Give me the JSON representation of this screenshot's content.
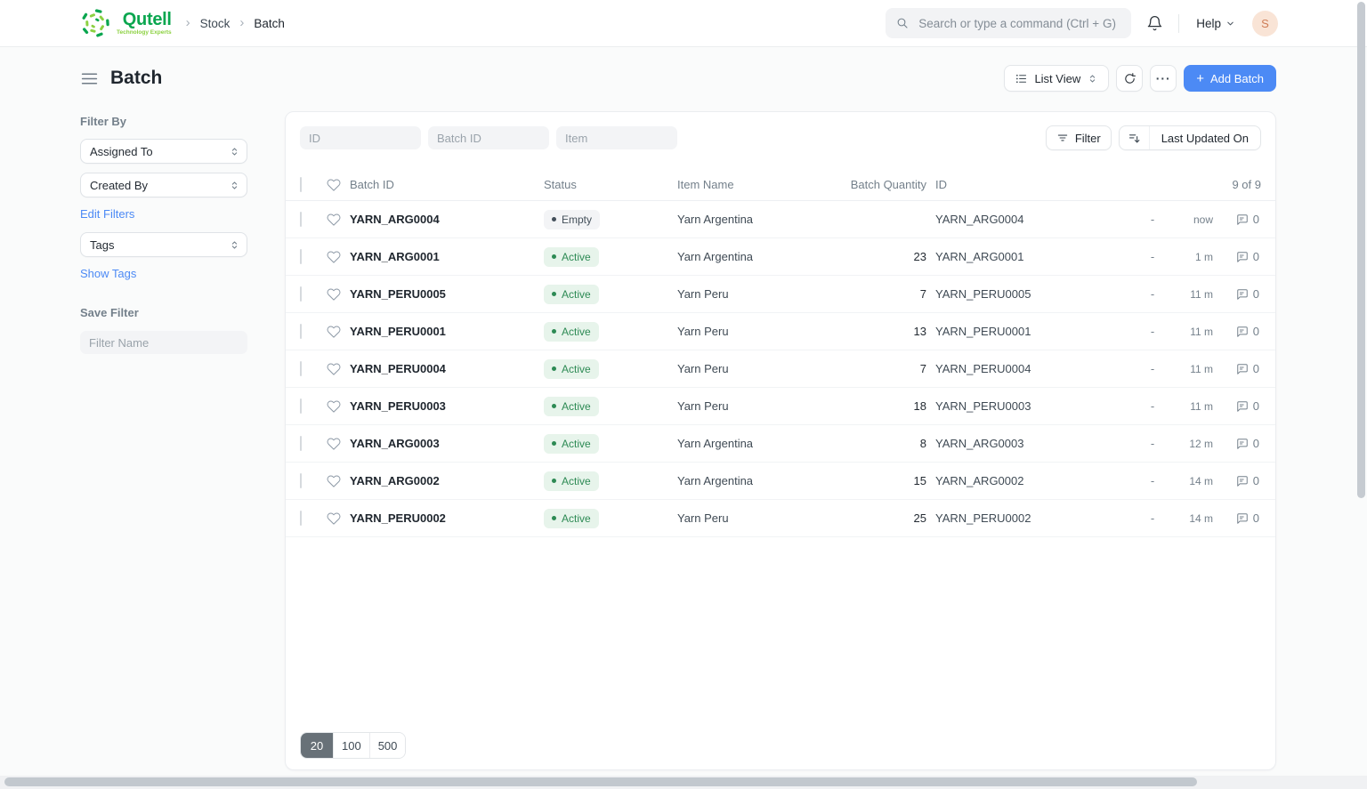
{
  "brand": {
    "name": "Qutell",
    "tagline": "Technology Experts"
  },
  "navbar": {
    "breadcrumb": [
      "Stock",
      "Batch"
    ],
    "search_placeholder": "Search or type a command (Ctrl + G)",
    "help_label": "Help",
    "avatar_initial": "S"
  },
  "page_header": {
    "title": "Batch",
    "view_selector_label": "List View",
    "more_label": "···",
    "add_button_label": "Add Batch"
  },
  "sidebar": {
    "filter_by_label": "Filter By",
    "assigned_to_label": "Assigned To",
    "created_by_label": "Created By",
    "edit_filters_link": "Edit Filters",
    "tags_label": "Tags",
    "show_tags_link": "Show Tags",
    "save_filter_label": "Save Filter",
    "filter_name_placeholder": "Filter Name"
  },
  "toolbar": {
    "id_placeholder": "ID",
    "batch_id_placeholder": "Batch ID",
    "item_placeholder": "Item",
    "filter_button_label": "Filter",
    "sort_button_label": "Last Updated On"
  },
  "table": {
    "columns": {
      "batch_id": "Batch ID",
      "status": "Status",
      "item_name": "Item Name",
      "batch_quantity": "Batch Quantity",
      "id": "ID"
    },
    "count_label": "9 of 9",
    "rows": [
      {
        "batch_id": "YARN_ARG0004",
        "status": "Empty",
        "item": "Yarn Argentina",
        "qty": "",
        "id": "YARN_ARG0004",
        "assign": "-",
        "modified": "now",
        "comments": "0"
      },
      {
        "batch_id": "YARN_ARG0001",
        "status": "Active",
        "item": "Yarn Argentina",
        "qty": "23",
        "id": "YARN_ARG0001",
        "assign": "-",
        "modified": "1 m",
        "comments": "0"
      },
      {
        "batch_id": "YARN_PERU0005",
        "status": "Active",
        "item": "Yarn Peru",
        "qty": "7",
        "id": "YARN_PERU0005",
        "assign": "-",
        "modified": "11 m",
        "comments": "0"
      },
      {
        "batch_id": "YARN_PERU0001",
        "status": "Active",
        "item": "Yarn Peru",
        "qty": "13",
        "id": "YARN_PERU0001",
        "assign": "-",
        "modified": "11 m",
        "comments": "0"
      },
      {
        "batch_id": "YARN_PERU0004",
        "status": "Active",
        "item": "Yarn Peru",
        "qty": "7",
        "id": "YARN_PERU0004",
        "assign": "-",
        "modified": "11 m",
        "comments": "0"
      },
      {
        "batch_id": "YARN_PERU0003",
        "status": "Active",
        "item": "Yarn Peru",
        "qty": "18",
        "id": "YARN_PERU0003",
        "assign": "-",
        "modified": "11 m",
        "comments": "0"
      },
      {
        "batch_id": "YARN_ARG0003",
        "status": "Active",
        "item": "Yarn Argentina",
        "qty": "8",
        "id": "YARN_ARG0003",
        "assign": "-",
        "modified": "12 m",
        "comments": "0"
      },
      {
        "batch_id": "YARN_ARG0002",
        "status": "Active",
        "item": "Yarn Argentina",
        "qty": "15",
        "id": "YARN_ARG0002",
        "assign": "-",
        "modified": "14 m",
        "comments": "0"
      },
      {
        "batch_id": "YARN_PERU0002",
        "status": "Active",
        "item": "Yarn Peru",
        "qty": "25",
        "id": "YARN_PERU0002",
        "assign": "-",
        "modified": "14 m",
        "comments": "0"
      }
    ]
  },
  "pagination": {
    "options": [
      "20",
      "100",
      "500"
    ],
    "selected": "20"
  },
  "colors": {
    "primary": "#4C8AF5",
    "link": "#4C8AF5",
    "brand_green": "#0AA64F",
    "brand_lime": "#8CD141",
    "active_badge_bg": "#E7F4EB",
    "active_badge_text": "#2D8A54",
    "empty_badge_bg": "#F3F4F6",
    "empty_badge_text": "#44505A",
    "avatar_bg": "#F9E4D6",
    "avatar_text": "#CE7D57",
    "page_size_selected_bg": "#687178"
  }
}
